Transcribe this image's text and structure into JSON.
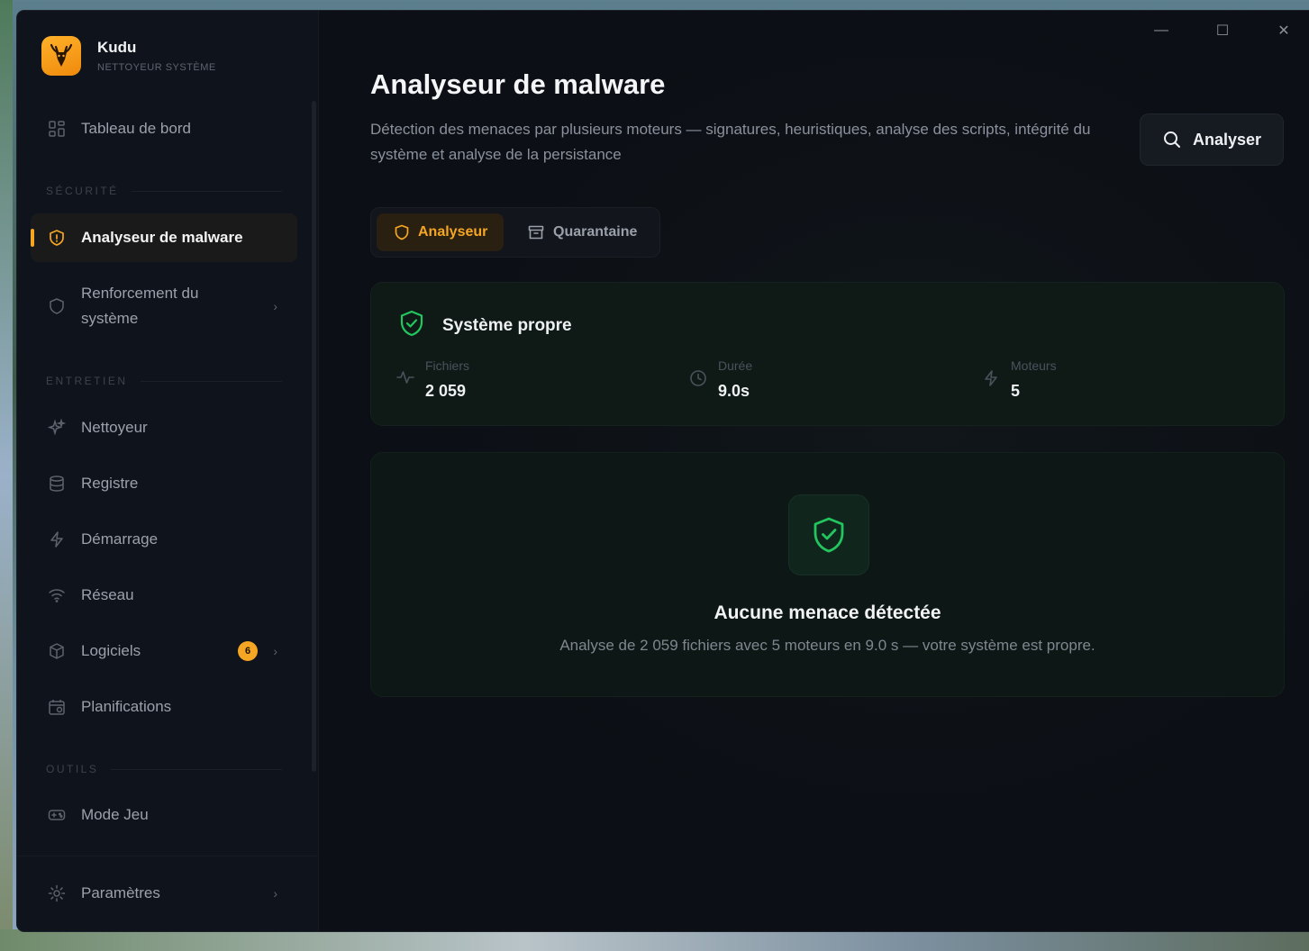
{
  "window": {
    "controls": {
      "minimize": "—",
      "maximize": "☐",
      "close": "✕"
    }
  },
  "brand": {
    "name": "Kudu",
    "subtitle": "NETTOYEUR SYSTÈME",
    "logo_icon": "kudu-logo-icon",
    "accent_color": "#f5a623"
  },
  "sidebar": {
    "dashboard": {
      "label": "Tableau de bord",
      "icon": "dashboard-grid-icon"
    },
    "sections": {
      "security": "SÉCURITÉ",
      "maintenance": "ENTRETIEN",
      "tools": "OUTILS"
    },
    "security_items": [
      {
        "label": "Analyseur de malware",
        "icon": "shield-icon",
        "active": true
      },
      {
        "label": "Renforcement du système",
        "icon": "shield-outline-icon",
        "active": false,
        "has_submenu": true
      }
    ],
    "maintenance_items": [
      {
        "label": "Nettoyeur",
        "icon": "sparkle-icon"
      },
      {
        "label": "Registre",
        "icon": "database-icon"
      },
      {
        "label": "Démarrage",
        "icon": "lightning-icon"
      },
      {
        "label": "Réseau",
        "icon": "wifi-icon"
      },
      {
        "label": "Logiciels",
        "icon": "package-icon",
        "badge": "6",
        "has_submenu": true
      },
      {
        "label": "Planifications",
        "icon": "calendar-icon"
      }
    ],
    "tools_items": [
      {
        "label": "Mode Jeu",
        "icon": "gamepad-icon"
      }
    ],
    "settings": {
      "label": "Paramètres",
      "icon": "gear-icon",
      "has_submenu": true
    }
  },
  "main": {
    "title": "Analyseur de malware",
    "description": "Détection des menaces par plusieurs moteurs — signatures, heuristiques, analyse des scripts, intégrité du système et analyse de la persistance",
    "analyze_button": "Analyser",
    "tabs": [
      {
        "label": "Analyseur",
        "icon": "shield-icon",
        "active": true
      },
      {
        "label": "Quarantaine",
        "icon": "archive-icon",
        "active": false
      }
    ],
    "summary": {
      "status": "Système propre",
      "status_color": "#22c55e",
      "stats": [
        {
          "name": "Fichiers",
          "value": "2 059",
          "icon": "activity-icon"
        },
        {
          "name": "Durée",
          "value": "9.0s",
          "icon": "clock-icon"
        },
        {
          "name": "Moteurs",
          "value": "5",
          "icon": "lightning-icon"
        }
      ]
    },
    "result": {
      "title": "Aucune menace détectée",
      "description": "Analyse de 2 059 fichiers avec 5 moteurs en 9.0 s — votre système est propre."
    }
  }
}
